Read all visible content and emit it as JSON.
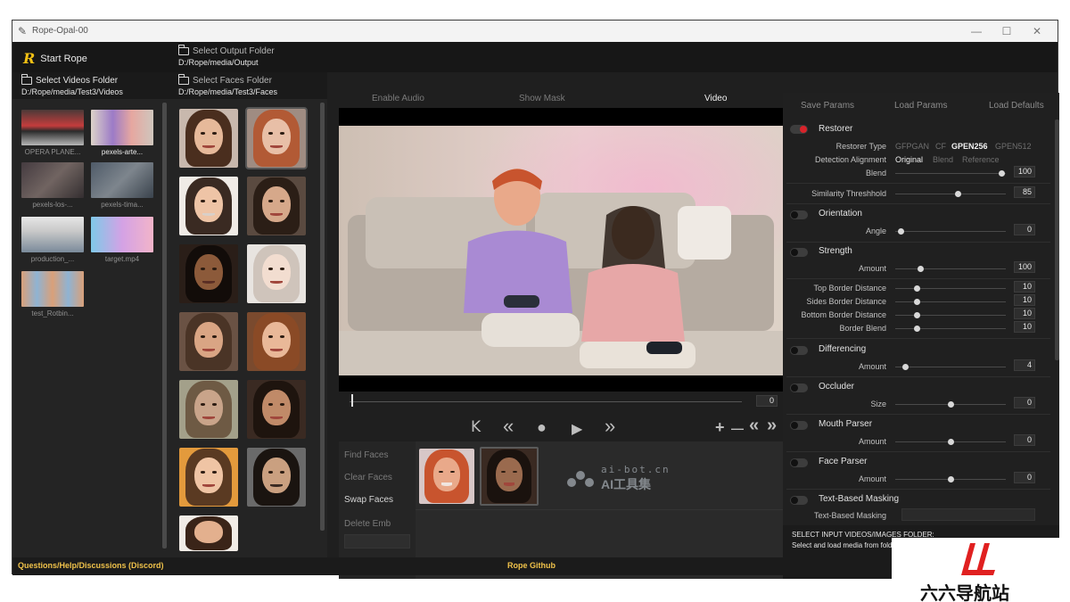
{
  "window": {
    "title": "Rope-Opal-00",
    "controls": {
      "minimize": "—",
      "maximize": "☐",
      "close": "✕"
    }
  },
  "topbar": {
    "start_label": "Start Rope",
    "output_folder": {
      "label": "Select Output Folder",
      "path": "D:/Rope/media/Output"
    }
  },
  "videos_panel": {
    "header": {
      "label": "Select Videos Folder",
      "path": "D:/Rope/media/Test3/Videos"
    },
    "items": [
      {
        "label": "OPERA PLANE...",
        "selected": false
      },
      {
        "label": "pexels-arte...",
        "selected": true
      },
      {
        "label": "pexels-los-...",
        "selected": false
      },
      {
        "label": "pexels-tima...",
        "selected": false
      },
      {
        "label": "production_...",
        "selected": false
      },
      {
        "label": "target.mp4",
        "selected": false
      },
      {
        "label": "test_Rotbin...",
        "selected": false
      }
    ]
  },
  "faces_panel": {
    "header": {
      "label": "Select Faces Folder",
      "path": "D:/Rope/media/Test3/Faces"
    }
  },
  "video_tabs": {
    "enable_audio": "Enable Audio",
    "show_mask": "Show Mask",
    "video": "Video"
  },
  "timeline": {
    "frame_value": "0"
  },
  "player_controls": {
    "to_start": "K",
    "rewind": "«",
    "record": "●",
    "play": "▶",
    "forward": "»",
    "zoom_in": "+",
    "zoom_out": "—",
    "back_marker": "«",
    "fwd_marker": "»"
  },
  "face_actions": {
    "find": "Find Faces",
    "clear": "Clear Faces",
    "swap": "Swap Faces",
    "delete": "Delete Emb"
  },
  "watermark": {
    "line1": "ai-bot.cn",
    "line2": "AI工具集"
  },
  "params": {
    "save": "Save Params",
    "load": "Load Params",
    "defaults": "Load Defaults",
    "restorer": {
      "title": "Restorer",
      "type_label": "Restorer Type",
      "type_options": [
        "GFPGAN",
        "CF",
        "GPEN256",
        "GPEN512"
      ],
      "type_selected": "GPEN256",
      "align_label": "Detection Alignment",
      "align_options": [
        "Original",
        "Blend",
        "Reference"
      ],
      "align_selected": "Original",
      "blend_label": "Blend",
      "blend_value": "100"
    },
    "similarity": {
      "label": "Similarity Threshhold",
      "value": "85"
    },
    "orientation": {
      "title": "Orientation",
      "label": "Angle",
      "value": "0"
    },
    "strength": {
      "title": "Strength",
      "label": "Amount",
      "value": "100"
    },
    "borders": [
      {
        "label": "Top Border Distance",
        "value": "10"
      },
      {
        "label": "Sides Border Distance",
        "value": "10"
      },
      {
        "label": "Bottom Border Distance",
        "value": "10"
      },
      {
        "label": "Border Blend",
        "value": "10"
      }
    ],
    "differencing": {
      "title": "Differencing",
      "label": "Amount",
      "value": "4"
    },
    "occluder": {
      "title": "Occluder",
      "label": "Size",
      "value": "0"
    },
    "mouth_parser": {
      "title": "Mouth Parser",
      "label": "Amount",
      "value": "0"
    },
    "face_parser": {
      "title": "Face Parser",
      "label": "Amount",
      "value": "0"
    },
    "text_masking": {
      "title": "Text-Based Masking",
      "label": "Text-Based Masking"
    }
  },
  "help": {
    "title": "SELECT INPUT VIDEOS/IMAGES FOLDER:",
    "body": "Select and load media from folder."
  },
  "footer": {
    "discord": "Questions/Help/Discussions (Discord)",
    "github": "Rope Github"
  },
  "brand": {
    "name": "六六导航站"
  },
  "colors": {
    "accent_red": "#d8232a",
    "gold": "#f0c24a",
    "bg": "#1f1f1f"
  }
}
